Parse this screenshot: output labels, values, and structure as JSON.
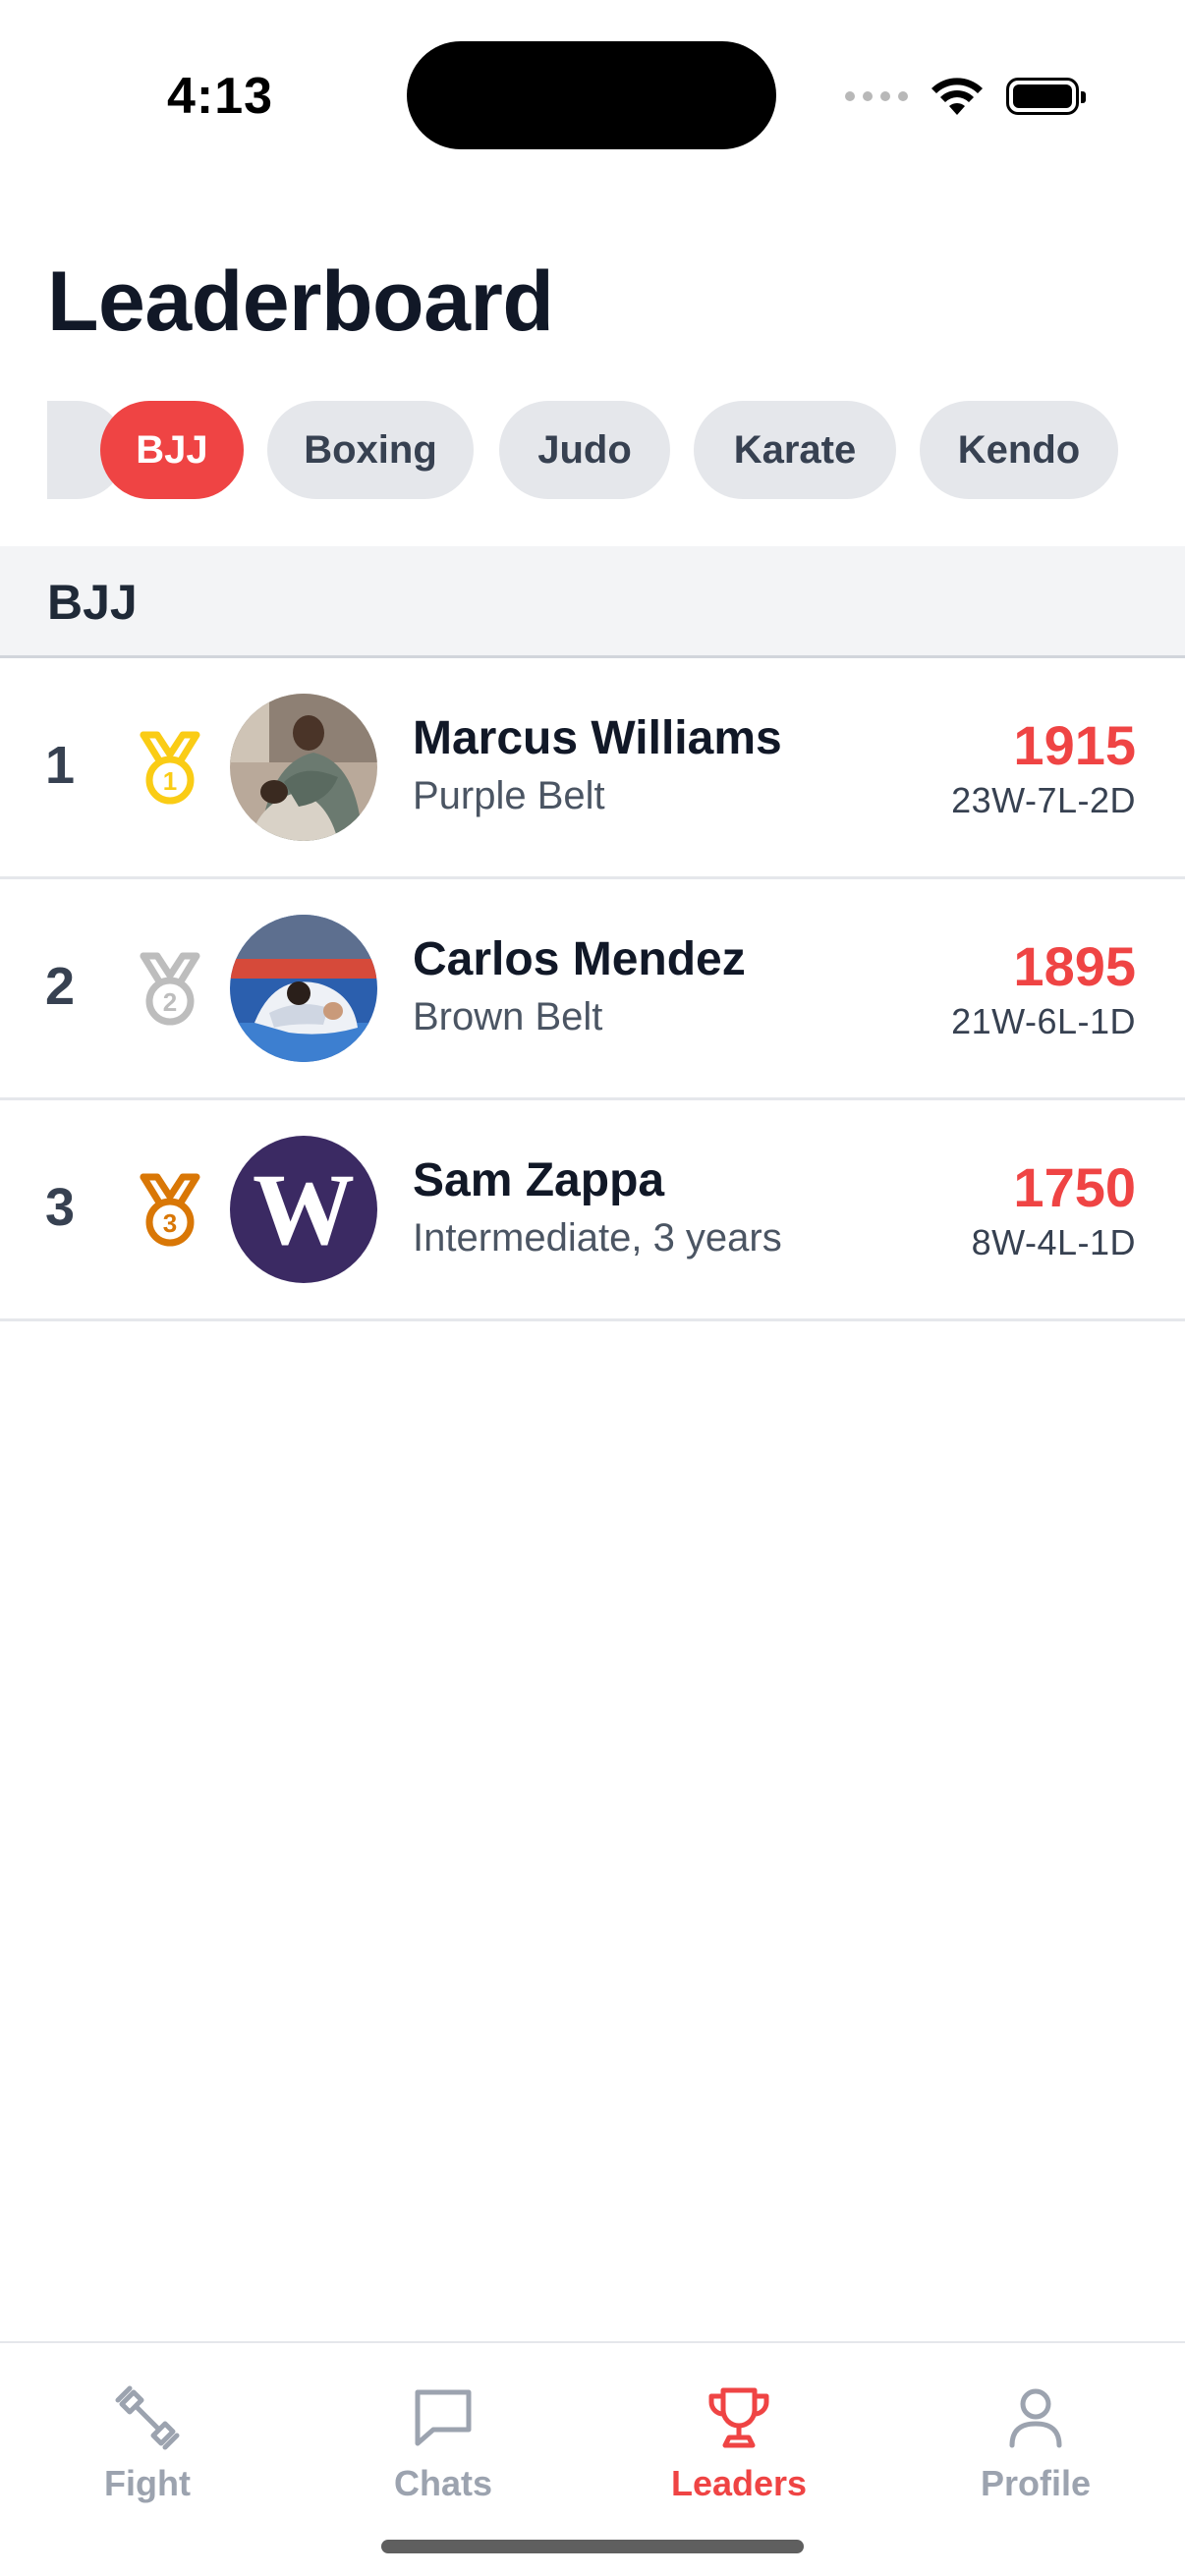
{
  "status_bar": {
    "time": "4:13"
  },
  "page": {
    "title": "Leaderboard"
  },
  "filters": {
    "chips": [
      {
        "label": "BJJ",
        "active": true
      },
      {
        "label": "Boxing",
        "active": false
      },
      {
        "label": "Judo",
        "active": false
      },
      {
        "label": "Karate",
        "active": false
      },
      {
        "label": "Kendo",
        "active": false
      }
    ]
  },
  "section": {
    "label": "BJJ"
  },
  "leaders": [
    {
      "rank": "1",
      "medal": "gold-medal-icon",
      "name": "Marcus Williams",
      "subtitle": "Purple Belt",
      "rating": "1915",
      "record": "23W-7L-2D"
    },
    {
      "rank": "2",
      "medal": "silver-medal-icon",
      "name": "Carlos Mendez",
      "subtitle": "Brown Belt",
      "rating": "1895",
      "record": "21W-6L-1D"
    },
    {
      "rank": "3",
      "medal": "bronze-medal-icon",
      "name": "Sam Zappa",
      "subtitle": "Intermediate, 3 years",
      "rating": "1750",
      "record": "8W-4L-1D",
      "avatar_letter": "W"
    }
  ],
  "tabbar": {
    "tabs": [
      {
        "label": "Fight",
        "icon": "dumbbell-icon",
        "active": false
      },
      {
        "label": "Chats",
        "icon": "chat-bubble-icon",
        "active": false
      },
      {
        "label": "Leaders",
        "icon": "trophy-icon",
        "active": true
      },
      {
        "label": "Profile",
        "icon": "person-icon",
        "active": false
      }
    ]
  },
  "colors": {
    "accent": "#ef4444",
    "gold": "#facc15",
    "silver": "#bdbdbd",
    "bronze": "#d97706",
    "avatar_purple": "#3b2a63"
  }
}
